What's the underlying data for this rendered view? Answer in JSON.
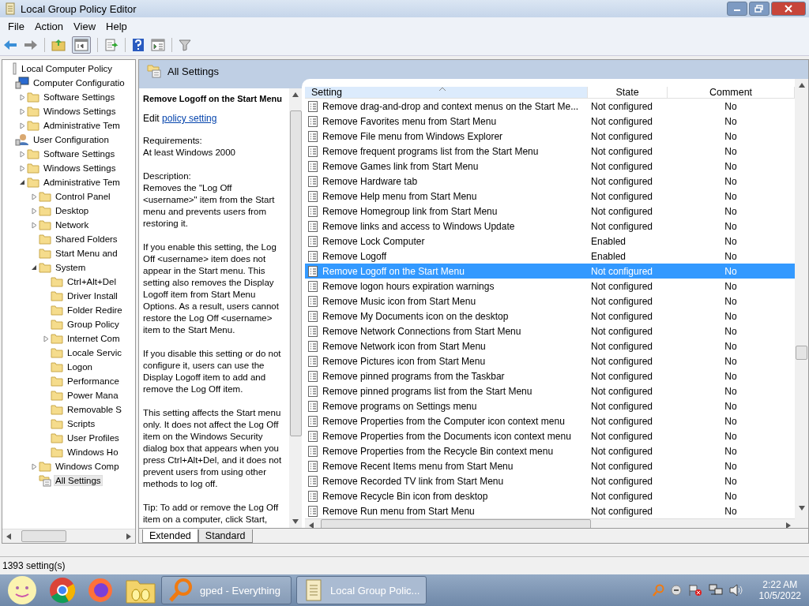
{
  "window": {
    "title": "Local Group Policy Editor"
  },
  "menu": [
    "File",
    "Action",
    "View",
    "Help"
  ],
  "tree": [
    {
      "label": "Local Computer Policy",
      "kind": "policy",
      "selected": false,
      "children": [
        {
          "label": "Computer Configuratio",
          "kind": "computer",
          "selected": false,
          "children": [
            {
              "label": "Software Settings",
              "kind": "folder",
              "expanded": false,
              "selected": false
            },
            {
              "label": "Windows Settings",
              "kind": "folder",
              "expanded": false,
              "selected": false
            },
            {
              "label": "Administrative Tem",
              "kind": "folder",
              "expanded": false,
              "selected": false
            }
          ]
        },
        {
          "label": "User Configuration",
          "kind": "user",
          "selected": false,
          "children": [
            {
              "label": "Software Settings",
              "kind": "folder",
              "expanded": false,
              "selected": false
            },
            {
              "label": "Windows Settings",
              "kind": "folder",
              "expanded": false,
              "selected": false
            },
            {
              "label": "Administrative Tem",
              "kind": "folder",
              "expanded": true,
              "selected": false,
              "children": [
                {
                  "label": "Control Panel",
                  "kind": "folder",
                  "expanded": false,
                  "selected": false
                },
                {
                  "label": "Desktop",
                  "kind": "folder",
                  "expanded": false,
                  "selected": false
                },
                {
                  "label": "Network",
                  "kind": "folder",
                  "expanded": false,
                  "selected": false
                },
                {
                  "label": "Shared Folders",
                  "kind": "folder",
                  "selected": false
                },
                {
                  "label": "Start Menu and",
                  "kind": "folder",
                  "selected": false
                },
                {
                  "label": "System",
                  "kind": "folder",
                  "expanded": true,
                  "selected": false,
                  "children": [
                    {
                      "label": "Ctrl+Alt+Del",
                      "kind": "folder",
                      "selected": false
                    },
                    {
                      "label": "Driver Install",
                      "kind": "folder",
                      "selected": false
                    },
                    {
                      "label": "Folder Redire",
                      "kind": "folder",
                      "selected": false
                    },
                    {
                      "label": "Group Policy",
                      "kind": "folder",
                      "selected": false
                    },
                    {
                      "label": "Internet Com",
                      "kind": "folder",
                      "expanded": false,
                      "selected": false
                    },
                    {
                      "label": "Locale Servic",
                      "kind": "folder",
                      "selected": false
                    },
                    {
                      "label": "Logon",
                      "kind": "folder",
                      "selected": false
                    },
                    {
                      "label": "Performance",
                      "kind": "folder",
                      "selected": false
                    },
                    {
                      "label": "Power Mana",
                      "kind": "folder",
                      "selected": false
                    },
                    {
                      "label": "Removable S",
                      "kind": "folder",
                      "selected": false
                    },
                    {
                      "label": "Scripts",
                      "kind": "folder",
                      "selected": false
                    },
                    {
                      "label": "User Profiles",
                      "kind": "folder",
                      "selected": false
                    },
                    {
                      "label": "Windows Ho",
                      "kind": "folder",
                      "selected": false
                    }
                  ]
                },
                {
                  "label": "Windows Comp",
                  "kind": "folder",
                  "expanded": false,
                  "selected": false
                },
                {
                  "label": "All Settings",
                  "kind": "settings",
                  "selected": true
                }
              ]
            }
          ]
        }
      ]
    }
  ],
  "header": {
    "title": "All Settings"
  },
  "description": {
    "title": "Remove Logoff on the Start Menu",
    "edit_prefix": "Edit",
    "edit_link": "policy setting",
    "paragraphs": [
      "Requirements:\nAt least Windows 2000",
      "Description:\nRemoves the \"Log Off <username>\" item from the Start menu and prevents users from restoring it.",
      "If you enable this setting, the Log Off <username> item does not appear in the Start menu. This setting also removes the Display Logoff item from Start Menu Options. As a result, users cannot restore the Log Off <username> item to the Start Menu.",
      "If you disable this setting or do not configure it, users can use the Display Logoff item to add and remove the Log Off item.",
      "This setting affects the Start menu only. It does not affect the Log Off item on the Windows Security dialog box that appears when you press Ctrl+Alt+Del, and it does not prevent users from using other methods to log off.",
      "Tip: To add or remove the Log Off item on a computer, click Start,"
    ]
  },
  "table": {
    "columns": [
      "Setting",
      "State",
      "Comment"
    ],
    "rows": [
      {
        "setting": "Remove drag-and-drop and context menus on the Start Me...",
        "state": "Not configured",
        "comment": "No",
        "selected": false
      },
      {
        "setting": "Remove Favorites menu from Start Menu",
        "state": "Not configured",
        "comment": "No",
        "selected": false
      },
      {
        "setting": "Remove File menu from Windows Explorer",
        "state": "Not configured",
        "comment": "No",
        "selected": false
      },
      {
        "setting": "Remove frequent programs list from the Start Menu",
        "state": "Not configured",
        "comment": "No",
        "selected": false
      },
      {
        "setting": "Remove Games link from Start Menu",
        "state": "Not configured",
        "comment": "No",
        "selected": false
      },
      {
        "setting": "Remove Hardware tab",
        "state": "Not configured",
        "comment": "No",
        "selected": false
      },
      {
        "setting": "Remove Help menu from Start Menu",
        "state": "Not configured",
        "comment": "No",
        "selected": false
      },
      {
        "setting": "Remove Homegroup link from Start Menu",
        "state": "Not configured",
        "comment": "No",
        "selected": false
      },
      {
        "setting": "Remove links and access to Windows Update",
        "state": "Not configured",
        "comment": "No",
        "selected": false
      },
      {
        "setting": "Remove Lock Computer",
        "state": "Enabled",
        "comment": "No",
        "selected": false
      },
      {
        "setting": "Remove Logoff",
        "state": "Enabled",
        "comment": "No",
        "selected": false
      },
      {
        "setting": "Remove Logoff on the Start Menu",
        "state": "Not configured",
        "comment": "No",
        "selected": true
      },
      {
        "setting": "Remove logon hours expiration warnings",
        "state": "Not configured",
        "comment": "No",
        "selected": false
      },
      {
        "setting": "Remove Music icon from Start Menu",
        "state": "Not configured",
        "comment": "No",
        "selected": false
      },
      {
        "setting": "Remove My Documents icon on the desktop",
        "state": "Not configured",
        "comment": "No",
        "selected": false
      },
      {
        "setting": "Remove Network Connections from Start Menu",
        "state": "Not configured",
        "comment": "No",
        "selected": false
      },
      {
        "setting": "Remove Network icon from Start Menu",
        "state": "Not configured",
        "comment": "No",
        "selected": false
      },
      {
        "setting": "Remove Pictures icon from Start Menu",
        "state": "Not configured",
        "comment": "No",
        "selected": false
      },
      {
        "setting": "Remove pinned programs from the Taskbar",
        "state": "Not configured",
        "comment": "No",
        "selected": false
      },
      {
        "setting": "Remove pinned programs list from the Start Menu",
        "state": "Not configured",
        "comment": "No",
        "selected": false
      },
      {
        "setting": "Remove programs on Settings menu",
        "state": "Not configured",
        "comment": "No",
        "selected": false
      },
      {
        "setting": "Remove Properties from the Computer icon context menu",
        "state": "Not configured",
        "comment": "No",
        "selected": false
      },
      {
        "setting": "Remove Properties from the Documents icon context menu",
        "state": "Not configured",
        "comment": "No",
        "selected": false
      },
      {
        "setting": "Remove Properties from the Recycle Bin context menu",
        "state": "Not configured",
        "comment": "No",
        "selected": false
      },
      {
        "setting": "Remove Recent Items menu from Start Menu",
        "state": "Not configured",
        "comment": "No",
        "selected": false
      },
      {
        "setting": "Remove Recorded TV link from Start Menu",
        "state": "Not configured",
        "comment": "No",
        "selected": false
      },
      {
        "setting": "Remove Recycle Bin icon from desktop",
        "state": "Not configured",
        "comment": "No",
        "selected": false
      },
      {
        "setting": "Remove Run menu from Start Menu",
        "state": "Not configured",
        "comment": "No",
        "selected": false
      }
    ]
  },
  "view_tabs": [
    {
      "label": "Extended",
      "selected": true
    },
    {
      "label": "Standard",
      "selected": false
    }
  ],
  "status_bar": "1393 setting(s)",
  "taskbar": {
    "tasks": [
      {
        "label": "gped - Everything",
        "kind": "search",
        "selected": false
      },
      {
        "label": "Local Group Polic...",
        "kind": "policy",
        "selected": true
      }
    ],
    "time": "2:22 AM",
    "date": "10/5/2022"
  }
}
